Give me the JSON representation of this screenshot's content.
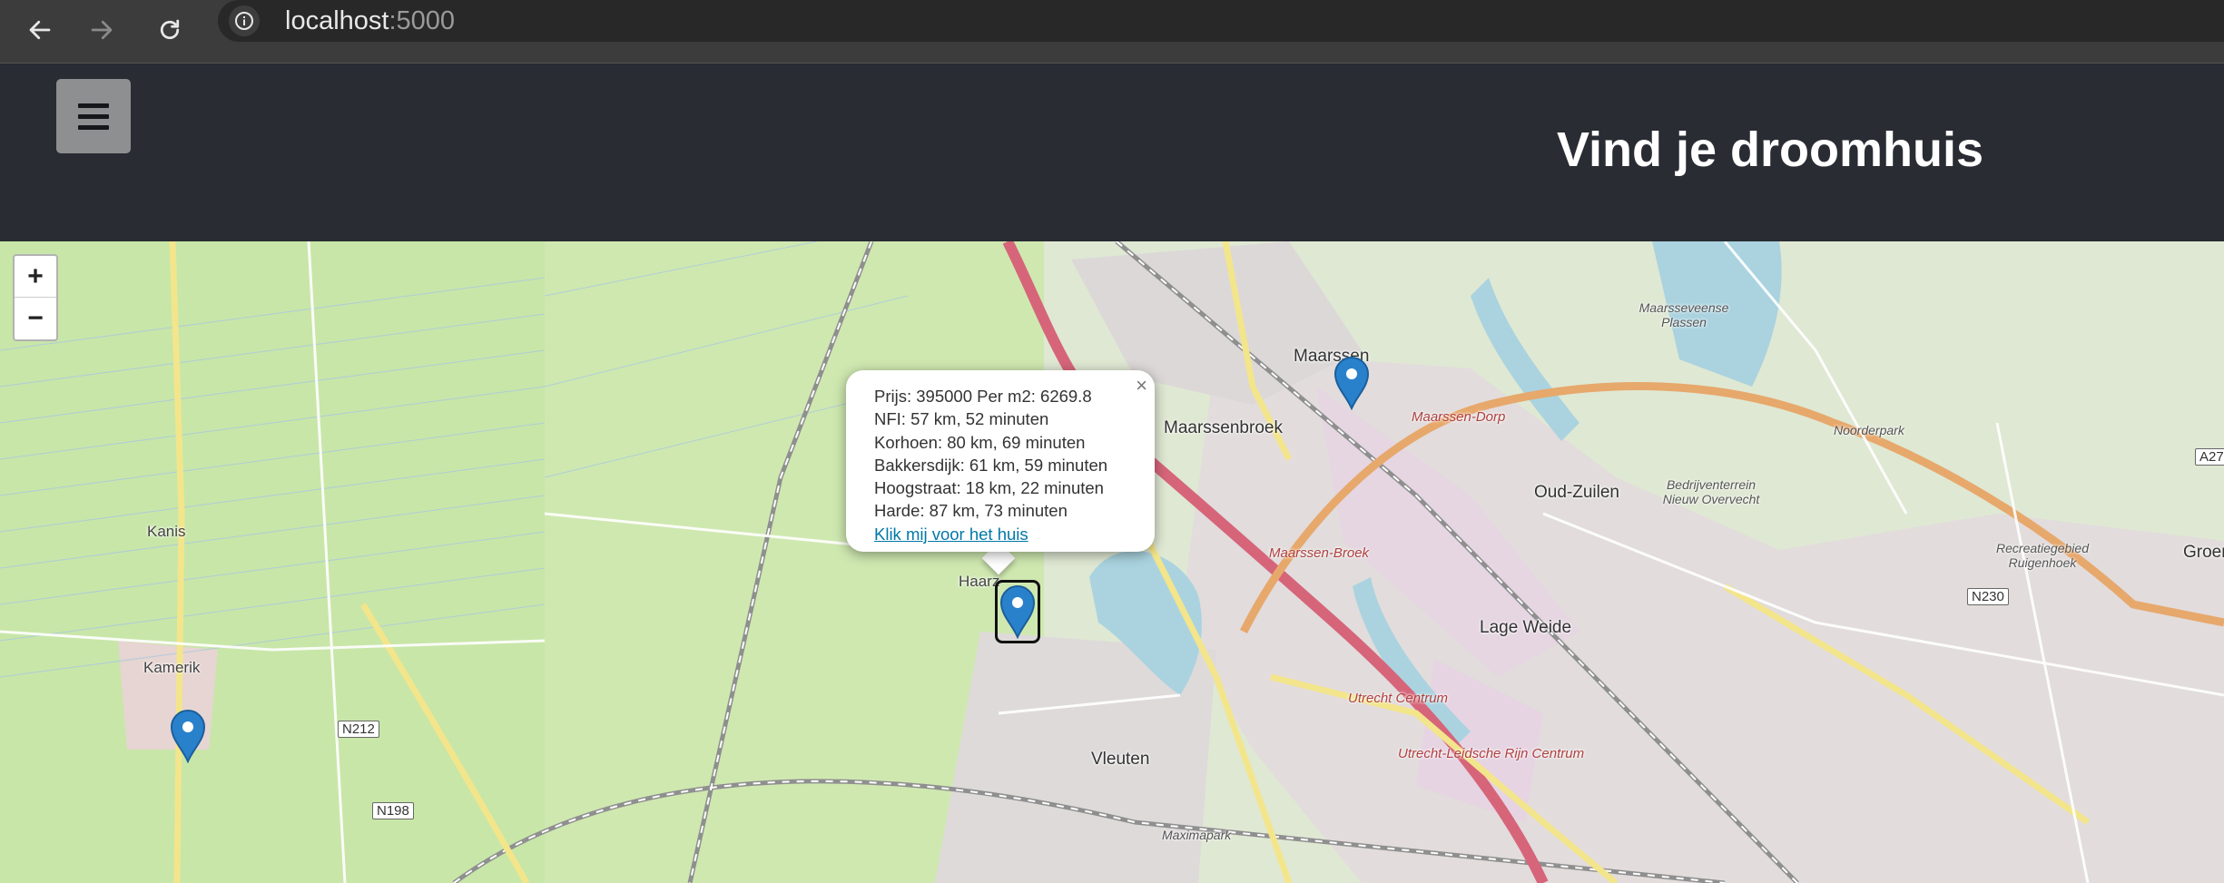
{
  "browser": {
    "back_icon": "arrow-left-icon",
    "forward_icon": "arrow-right-icon",
    "reload_icon": "reload-icon",
    "info_icon": "info-icon",
    "url_host": "localhost",
    "url_port": ":5000"
  },
  "header": {
    "menu_icon": "hamburger-icon",
    "title": "Vind je droomhuis"
  },
  "map": {
    "zoom_in": "+",
    "zoom_out": "−",
    "labels": {
      "maarssen": "Maarssen",
      "maarssenbroek": "Maarssenbroek",
      "oud_zuilen": "Oud-Zuilen",
      "kanis": "Kanis",
      "kamerik": "Kamerik",
      "vleuten": "Vleuten",
      "lage_weide": "Lage Weide",
      "haarzuilens": "Haarz",
      "groenekan": "Groene",
      "bedrijventerrein": "Bedrijventerrein Nieuw Overvecht",
      "noorderpark": "Noorderpark",
      "ruigenhoek": "Recreatiegebied Ruigenhoek",
      "maarsseveense_plassen": "Maarsseveense Plassen",
      "maarssen_dorp": "Maarssen-Dorp",
      "maarssen_broek": "Maarssen-Broek",
      "utrecht_centrum": "Utrecht Centrum",
      "utrecht_leidsche_rijn": "Utrecht-Leidsche Rijn Centrum",
      "maximapark": "Maximapark",
      "n212": "N212",
      "n198": "N198",
      "n230": "N230",
      "a27": "A27"
    },
    "markers": [
      {
        "name": "Maarssen",
        "icon": "map-marker-icon"
      },
      {
        "name": "Haarzuilens (selected)",
        "icon": "map-marker-icon"
      },
      {
        "name": "Kamerik",
        "icon": "map-marker-icon"
      }
    ]
  },
  "popup": {
    "close": "×",
    "lines": [
      "Prijs: 395000 Per m2: 6269.8",
      "NFI: 57 km, 52 minuten",
      "Korhoen: 80 km, 69 minuten",
      "Bakkersdijk: 61 km, 59 minuten",
      "Hoogstraat: 18 km, 22 minuten",
      "Harde: 87 km, 73 minuten"
    ],
    "link": "Klik mij voor het huis"
  },
  "colors": {
    "chrome_bg": "#3c3c3c",
    "header_bg": "#292c33",
    "menu_button": "#8e8f91",
    "map_bg": "#cfe8b0",
    "marker": "#2a81cb",
    "link": "#0078a8"
  }
}
